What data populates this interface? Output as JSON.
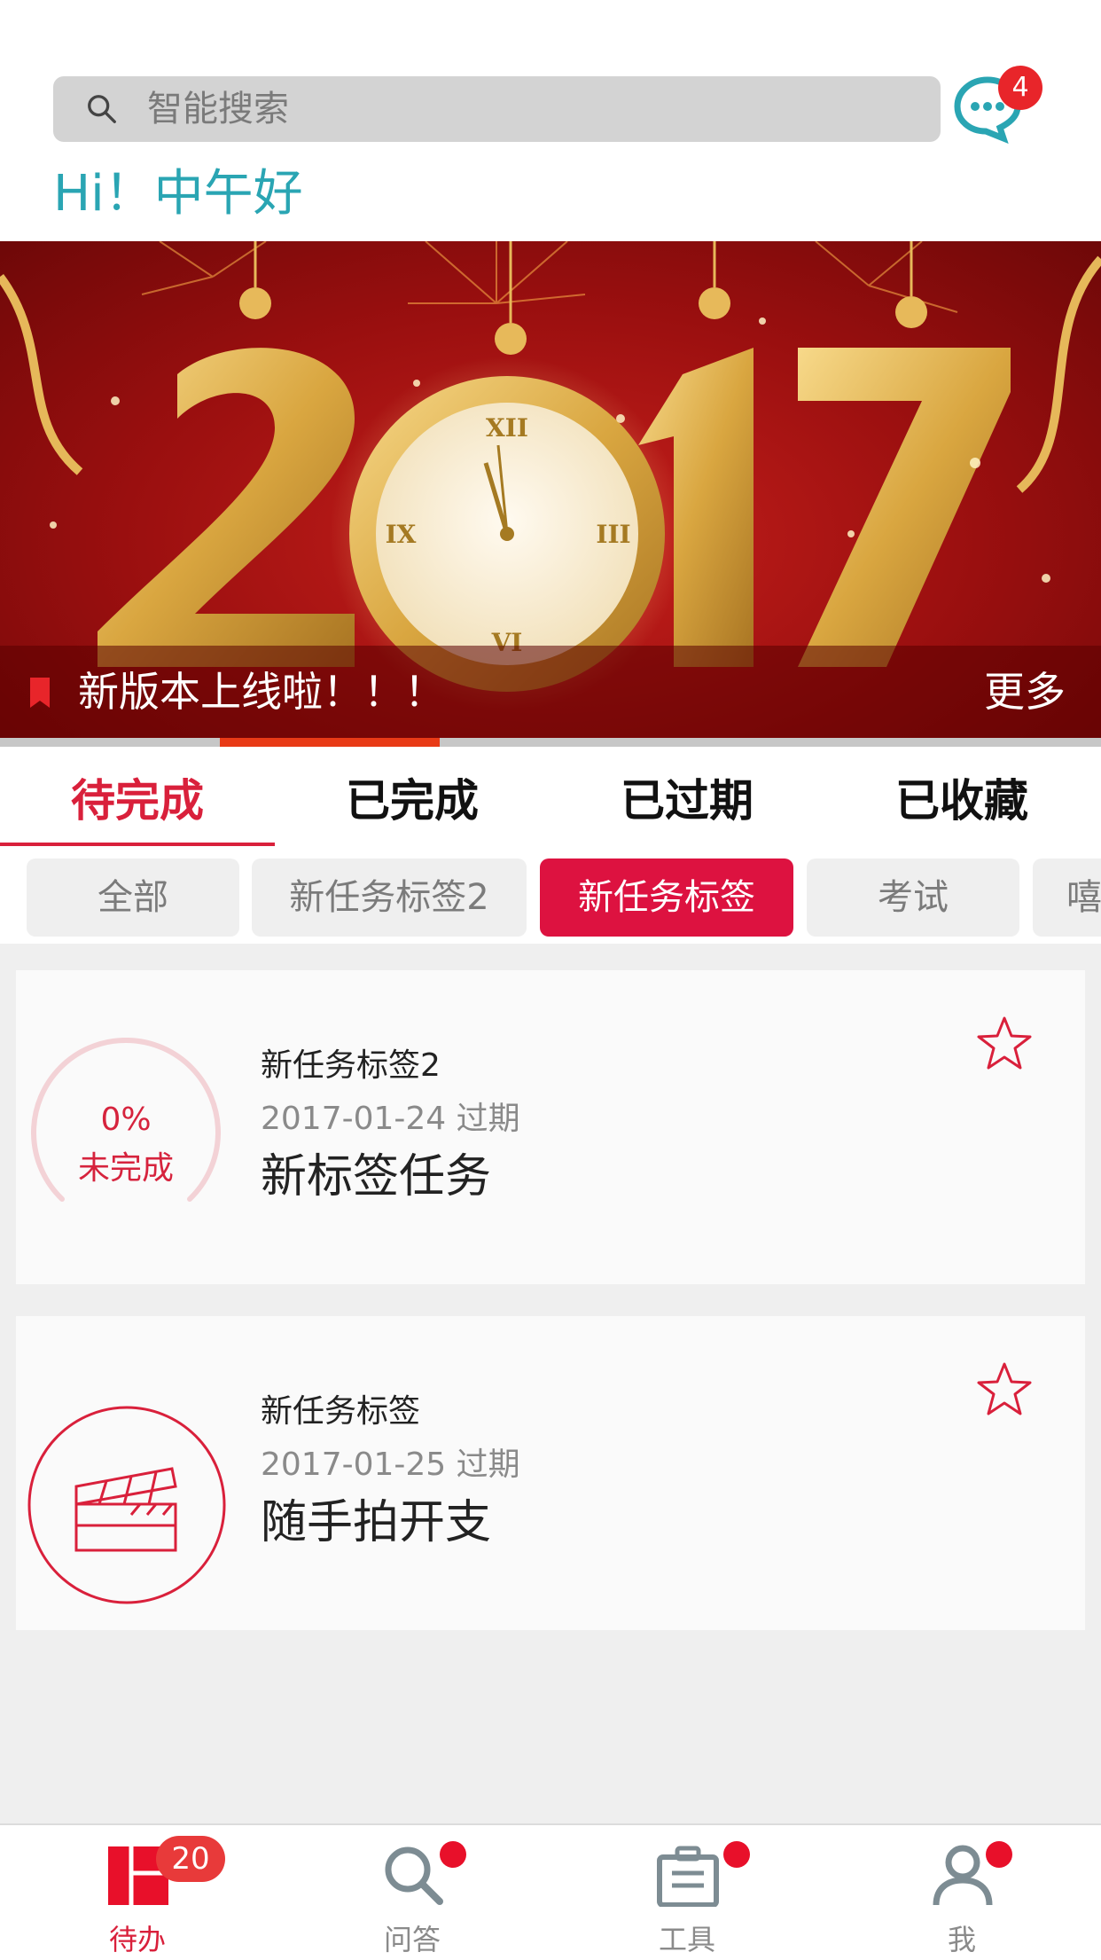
{
  "header": {
    "search_placeholder": "智能搜索",
    "message_badge": "4",
    "greeting": "Hi！中午好"
  },
  "banner": {
    "caption": "新版本上线啦！！！",
    "more": "更多",
    "year": "2017",
    "slide_position": "2"
  },
  "tabs": [
    {
      "label": "待完成",
      "active": true
    },
    {
      "label": "已完成",
      "active": false
    },
    {
      "label": "已过期",
      "active": false
    },
    {
      "label": "已收藏",
      "active": false
    }
  ],
  "chips": [
    {
      "label": "全部",
      "active": false
    },
    {
      "label": "新任务标签2",
      "active": false
    },
    {
      "label": "新任务标签",
      "active": true
    },
    {
      "label": "考试",
      "active": false
    },
    {
      "label": "嘻",
      "active": false
    }
  ],
  "tasks": [
    {
      "tag": "新任务标签2",
      "date": "2017-01-24 过期",
      "title": "新标签任务",
      "progress_text": "0%",
      "status_text": "未完成",
      "progress": 0
    },
    {
      "tag": "新任务标签",
      "date": "2017-01-25 过期",
      "title": "随手拍开支",
      "icon": "clapperboard-icon"
    }
  ],
  "bottom_nav": [
    {
      "label": "待办",
      "badge": "20",
      "icon": "todo-icon",
      "active": true
    },
    {
      "label": "问答",
      "icon": "search-icon",
      "dot": true
    },
    {
      "label": "工具",
      "icon": "briefcase-icon",
      "dot": true
    },
    {
      "label": "我",
      "icon": "person-icon",
      "dot": true
    }
  ],
  "colors": {
    "accent": "#d9203b",
    "greeting": "#2aa5b3",
    "badge": "#e8252a"
  }
}
